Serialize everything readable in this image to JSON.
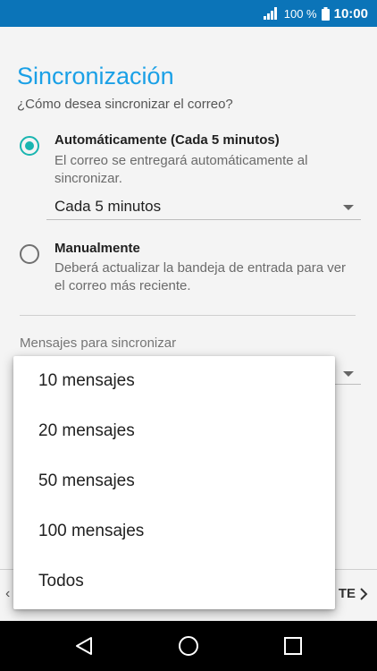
{
  "status_bar": {
    "battery_text": "100 %",
    "clock": "10:00"
  },
  "page": {
    "title": "Sincronización",
    "question": "¿Cómo desea sincronizar el correo?"
  },
  "options": {
    "auto": {
      "title": "Automáticamente (Cada 5 minutos)",
      "description": "El correo se entregará automáticamente al sincronizar.",
      "selected": true
    },
    "interval_select": {
      "value": "Cada 5 minutos"
    },
    "manual": {
      "title": "Manualmente",
      "description": "Deberá actualizar la bandeja de entrada para ver el correo más reciente.",
      "selected": false
    }
  },
  "messages_section": {
    "label": "Mensajes para sincronizar"
  },
  "bottom_bar": {
    "next_label": "TE"
  },
  "dropdown": {
    "items": [
      "10 mensajes",
      "20 mensajes",
      "50 mensajes",
      "100 mensajes",
      "Todos"
    ]
  },
  "colors": {
    "accent": "#19b5b0",
    "title": "#1aa0e6",
    "status_bar": "#0b74b8"
  },
  "icons": {
    "signal": "signal-icon",
    "battery": "battery-icon",
    "back": "back-triangle-icon",
    "home": "home-icon",
    "recents": "recents-square-icon"
  }
}
